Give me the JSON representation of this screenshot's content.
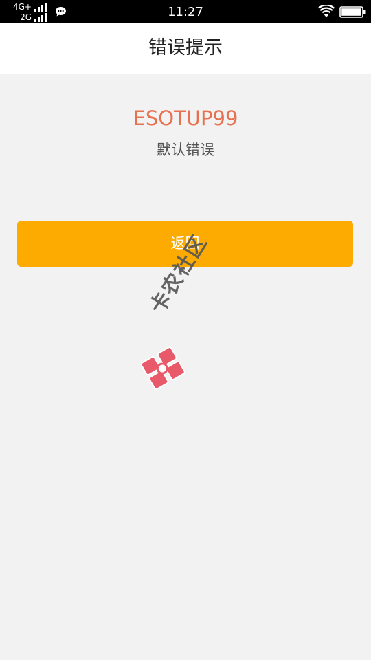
{
  "status_bar": {
    "network_top": "4G+",
    "network_bottom": "2G",
    "time": "11:27",
    "icons": [
      "signal-icon",
      "chat-bubble-icon",
      "wifi-icon",
      "battery-icon"
    ]
  },
  "header": {
    "title": "错误提示"
  },
  "error": {
    "code": "ESOTUP99",
    "message": "默认错误"
  },
  "actions": {
    "back_label": "返回"
  },
  "watermark": {
    "text": "卡农社区"
  },
  "colors": {
    "status_bar_bg": "#000000",
    "header_bg": "#ffffff",
    "page_bg": "#f2f2f3",
    "error_code": "#e8704f",
    "button_bg": "#fdab00",
    "button_text": "#ffffff",
    "watermark_logo": "#e85a6a"
  }
}
